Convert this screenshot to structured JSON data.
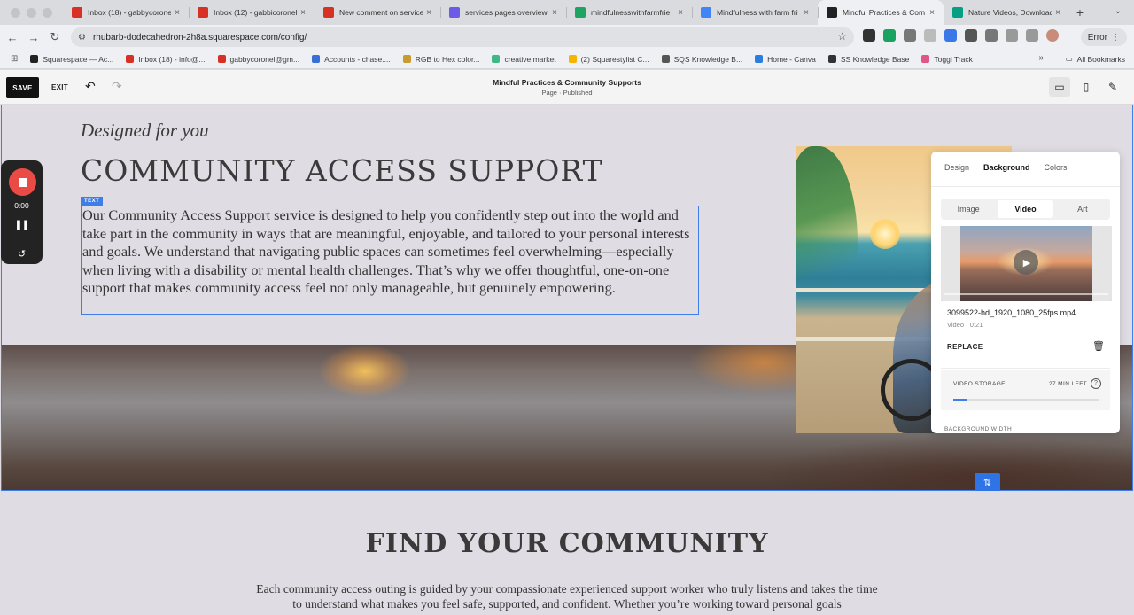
{
  "browser": {
    "tabs": [
      {
        "label": "Inbox (18) - gabbycorone",
        "icon": "gmail-icon",
        "color": "#d93025"
      },
      {
        "label": "Inbox (12) - gabbicoronel",
        "icon": "gmail-icon",
        "color": "#d93025"
      },
      {
        "label": "New comment on service",
        "icon": "gmail-icon",
        "color": "#d93025"
      },
      {
        "label": "services pages overview",
        "icon": "asana-icon",
        "color": "#6b5be6"
      },
      {
        "label": "mindfulnesswithfarmfrie",
        "icon": "drive-icon",
        "color": "#1ea362"
      },
      {
        "label": "Mindfulness with farm fri",
        "icon": "docs-icon",
        "color": "#4285f4"
      },
      {
        "label": "Mindful Practices & Com",
        "icon": "squarespace-icon",
        "color": "#222222",
        "active": true
      },
      {
        "label": "Nature Videos, Download",
        "icon": "pexels-icon",
        "color": "#05a081"
      }
    ],
    "url": "rhubarb-dodecahedron-2h8a.squarespace.com/config/",
    "error_label": "Error",
    "bookmarks": [
      {
        "label": "Squarespace — Ac...",
        "color": "#222222"
      },
      {
        "label": "Inbox (18) - info@...",
        "color": "#d93025"
      },
      {
        "label": "gabbycoronel@gm...",
        "color": "#d93025"
      },
      {
        "label": "Accounts - chase....",
        "color": "#3b6fd8"
      },
      {
        "label": "RGB to Hex color...",
        "color": "#c99a2e"
      },
      {
        "label": "creative market",
        "color": "#3fb886"
      },
      {
        "label": "(2) Squarestylist C...",
        "color": "#f5b400"
      },
      {
        "label": "SQS Knowledge B...",
        "color": "#555555"
      },
      {
        "label": "Home - Canva",
        "color": "#2a7de1"
      },
      {
        "label": "SS Knowledge Base",
        "color": "#333333"
      },
      {
        "label": "Toggl Track",
        "color": "#e05786"
      }
    ],
    "all_bookmarks": "All Bookmarks"
  },
  "editor": {
    "save_label": "SAVE",
    "exit_label": "EXIT",
    "page_title": "Mindful Practices & Community Supports",
    "page_status": "Page · Published"
  },
  "section1": {
    "eyebrow": "Designed for you",
    "headline": "COMMUNITY ACCESS SUPPORT",
    "text_label": "TEXT",
    "body": "Our Community Access Support service is designed to help you confidently step out into the world and take part in the community in ways that are meaningful, enjoyable, and tailored to your personal interests and goals. We understand that navigating public spaces can sometimes feel overwhelming—especially when living with a disability or mental health challenges. That’s why we offer thoughtful, one-on-one support that makes community access feel not only manageable, but genuinely empowering."
  },
  "panel": {
    "tabs": [
      "Design",
      "Background",
      "Colors"
    ],
    "active_tab": "Background",
    "types": [
      "Image",
      "Video",
      "Art"
    ],
    "active_type": "Video",
    "file_name": "3099522-hd_1920_1080_25fps.mp4",
    "file_meta": "Video · 0:21",
    "replace_label": "REPLACE",
    "storage_label": "VIDEO STORAGE",
    "storage_left": "27 MIN LEFT",
    "storage_used_fraction": 0.1,
    "background_width_label": "BACKGROUND WIDTH"
  },
  "section2": {
    "headline": "FIND YOUR COMMUNITY",
    "body": "Each community access outing is guided by your compassionate experienced support worker who truly listens and takes the time to understand what makes you feel safe, supported, and confident. Whether you’re working toward personal goals"
  },
  "recorder": {
    "time": "0:00"
  },
  "colors": {
    "accent": "#3f7ee8",
    "record": "#ea4b45"
  }
}
